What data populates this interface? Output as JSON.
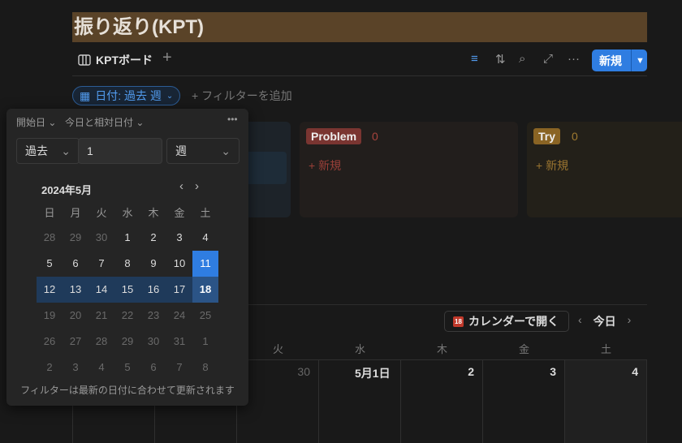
{
  "page": {
    "title": "振り返り(KPT)"
  },
  "view": {
    "tab_label": "KPTボード",
    "add": "+",
    "new_label": "新規"
  },
  "toolbar": {
    "icons": [
      "filter-icon",
      "sort-icon",
      "search-icon",
      "expand-icon",
      "more-icon"
    ]
  },
  "filter": {
    "chip_label": "日付: 過去 週",
    "add_filter": "+ フィルターを追加"
  },
  "board": {
    "columns": [
      {
        "label": "Problem",
        "count": "0",
        "add": "+ 新規",
        "color": "#8c3b36"
      },
      {
        "label": "Try",
        "count": "0",
        "add": "+ 新規",
        "color": "#8a6424"
      }
    ]
  },
  "calendar_view": {
    "open_button": "カレンダーで開く",
    "icon_day": "18",
    "today": "今日",
    "prev": "‹",
    "next": "›",
    "weekdays": [
      "火",
      "水",
      "木",
      "金",
      "土"
    ],
    "cells": [
      "30",
      "5月1日",
      "2",
      "3",
      "4"
    ]
  },
  "popup": {
    "property": "開始日",
    "mode": "今日と相対日付",
    "more": "•••",
    "direction": "過去",
    "amount": "1",
    "unit": "週",
    "month": "2024年5月",
    "weekdays": [
      "日",
      "月",
      "火",
      "水",
      "木",
      "金",
      "土"
    ],
    "weeks": [
      [
        "28",
        "29",
        "30",
        "1",
        "2",
        "3",
        "4"
      ],
      [
        "5",
        "6",
        "7",
        "8",
        "9",
        "10",
        "11"
      ],
      [
        "12",
        "13",
        "14",
        "15",
        "16",
        "17",
        "18"
      ],
      [
        "19",
        "20",
        "21",
        "22",
        "23",
        "24",
        "25"
      ],
      [
        "26",
        "27",
        "28",
        "29",
        "30",
        "31",
        "1"
      ],
      [
        "2",
        "3",
        "4",
        "5",
        "6",
        "7",
        "8"
      ]
    ],
    "today": "11",
    "range_end": "18",
    "note": "フィルターは最新の日付に合わせて更新されます"
  }
}
